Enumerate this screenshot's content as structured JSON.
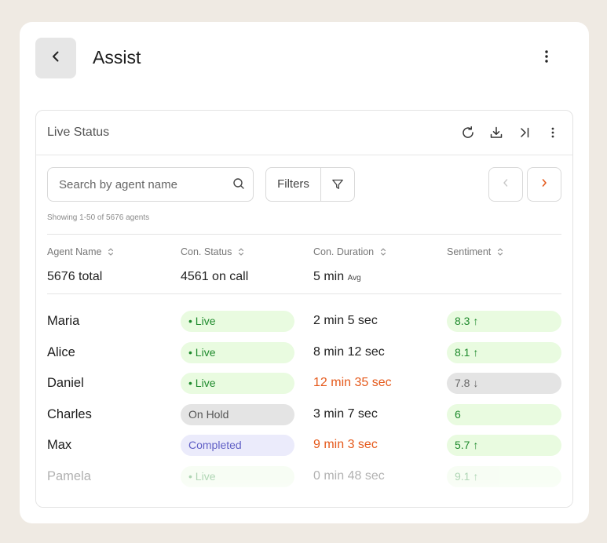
{
  "header": {
    "title": "Assist"
  },
  "card": {
    "title": "Live Status",
    "search_placeholder": "Search by agent name",
    "filters_label": "Filters",
    "showing": "Showing 1-50 of 5676 agents"
  },
  "columns": [
    {
      "label": "Agent Name"
    },
    {
      "label": "Con. Status"
    },
    {
      "label": "Con. Duration"
    },
    {
      "label": "Sentiment"
    }
  ],
  "summary": {
    "agents": "5676 total",
    "on_call": "4561 on call",
    "duration": "5 min",
    "duration_suffix": "Avg"
  },
  "rows": [
    {
      "name": "Maria",
      "status": "Live",
      "status_kind": "live",
      "duration": "2 min 5 sec",
      "duration_warn": false,
      "sentiment": "8.3",
      "trend": "up",
      "sentiment_kind": "pos"
    },
    {
      "name": "Alice",
      "status": "Live",
      "status_kind": "live",
      "duration": "8 min 12 sec",
      "duration_warn": false,
      "sentiment": "8.1",
      "trend": "up",
      "sentiment_kind": "pos"
    },
    {
      "name": "Daniel",
      "status": "Live",
      "status_kind": "live",
      "duration": "12 min 35 sec",
      "duration_warn": true,
      "sentiment": "7.8",
      "trend": "down",
      "sentiment_kind": "neg"
    },
    {
      "name": "Charles",
      "status": "On Hold",
      "status_kind": "hold",
      "duration": "3 min 7 sec",
      "duration_warn": false,
      "sentiment": "6",
      "trend": "none",
      "sentiment_kind": "pos"
    },
    {
      "name": "Max",
      "status": "Completed",
      "status_kind": "done",
      "duration": "9 min 3 sec",
      "duration_warn": true,
      "sentiment": "5.7",
      "trend": "up",
      "sentiment_kind": "pos"
    },
    {
      "name": "Pamela",
      "status": "Live",
      "status_kind": "live",
      "duration": "0 min 48 sec",
      "duration_warn": false,
      "sentiment": "9.1",
      "trend": "up",
      "sentiment_kind": "pos"
    }
  ],
  "icons": {
    "back": "chevron-left-icon",
    "more": "more-vertical-icon",
    "refresh": "refresh-icon",
    "download": "download-icon",
    "collapse": "collapse-right-icon",
    "search": "search-icon",
    "filter": "filter-icon"
  },
  "colors": {
    "accent": "#e55a1c",
    "live_bg": "#e9fbe0",
    "live_text": "#1e8a2c",
    "hold_bg": "#e4e4e4",
    "done_bg": "#ebebfb",
    "done_text": "#6160c6"
  }
}
